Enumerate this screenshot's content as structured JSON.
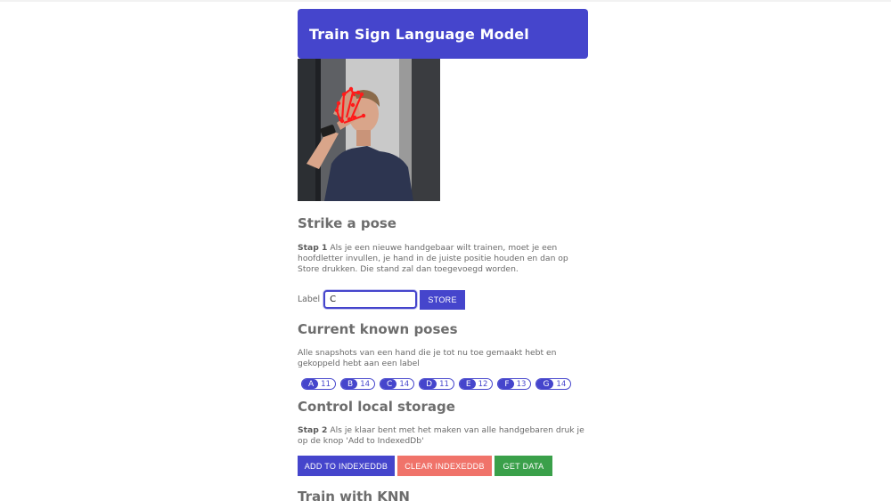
{
  "header": {
    "title": "Train Sign Language Model"
  },
  "pose": {
    "heading": "Strike a pose",
    "step_label": "Stap 1",
    "step_text": "Als je een nieuwe handgebaar wilt trainen, moet je een hoofdletter invullen, je hand in de juiste positie houden en dan op Store drukken. Die stand zal dan toegevoegd worden.",
    "label_caption": "Label",
    "label_value": "C",
    "store_button": "STORE"
  },
  "known": {
    "heading": "Current known poses",
    "description": "Alle snapshots van een hand die je tot nu toe gemaakt hebt en gekoppeld hebt aan een label",
    "poses": [
      {
        "label": "A",
        "count": "11"
      },
      {
        "label": "B",
        "count": "14"
      },
      {
        "label": "C",
        "count": "14"
      },
      {
        "label": "D",
        "count": "11"
      },
      {
        "label": "E",
        "count": "12"
      },
      {
        "label": "F",
        "count": "13"
      },
      {
        "label": "G",
        "count": "14"
      }
    ]
  },
  "storage": {
    "heading": "Control local storage",
    "step_label": "Stap 2",
    "step_text": "Als je klaar bent met het maken van alle handgebaren druk je op de knop 'Add to IndexedDb'",
    "add_button": "ADD TO INDEXEDDB",
    "clear_button": "CLEAR INDEXEDDB",
    "get_button": "GET DATA"
  },
  "train": {
    "heading": "Train with KNN"
  },
  "colors": {
    "primary": "#4545cc",
    "danger": "#f0736a",
    "success": "#3aa04a"
  }
}
